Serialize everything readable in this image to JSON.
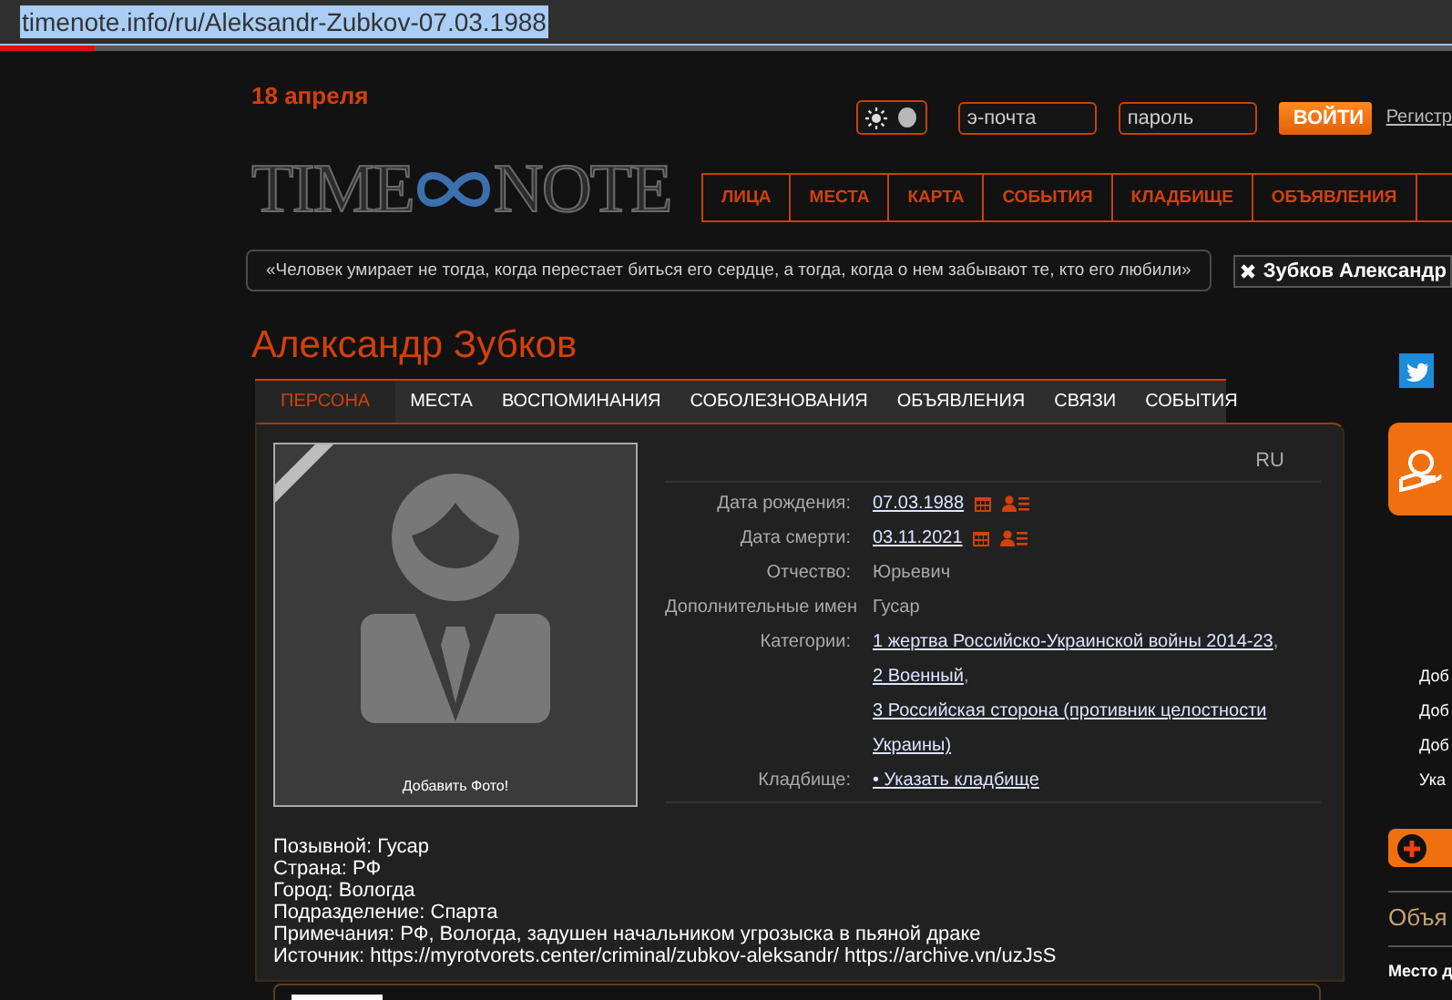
{
  "address_bar": {
    "url": "timenote.info/ru/Aleksandr-Zubkov-07.03.1988",
    "load_progress": {
      "level": 0.065
    }
  },
  "header": {
    "date": "18 апреля",
    "theme_toggle": {
      "on": true
    },
    "email_field": {
      "placeholder": "э-почта"
    },
    "password_field": {
      "placeholder": "пароль"
    },
    "login_button": "ВОЙТИ",
    "register_link": "Регистр"
  },
  "logo": {
    "left": "TIME",
    "right": "NOTE"
  },
  "nav": [
    {
      "label": "ЛИЦА"
    },
    {
      "label": "МЕСТА"
    },
    {
      "label": "КАРТА"
    },
    {
      "label": "СОБЫТИЯ"
    },
    {
      "label": "КЛАДБИЩЕ"
    },
    {
      "label": "ОБЪЯВЛЕНИЯ"
    }
  ],
  "quote": "«Человек умирает не тогда, когда перестает биться его сердце, а тогда, когда о нем забывают те, кто его любили»",
  "search_chip": {
    "label": "Зубков Александр"
  },
  "person": {
    "name": "Александр Зубков"
  },
  "tabs": [
    {
      "label": "ПЕРСОНА",
      "selected": true
    },
    {
      "label": "МЕСТА",
      "selected": false
    },
    {
      "label": "ВОСПОМИНАНИЯ",
      "selected": false
    },
    {
      "label": "СОБОЛЕЗНОВАНИЯ",
      "selected": false
    },
    {
      "label": "ОБЪЯВЛЕНИЯ",
      "selected": false
    },
    {
      "label": "СВЯЗИ",
      "selected": false
    },
    {
      "label": "СОБЫТИЯ",
      "selected": false
    }
  ],
  "profile": {
    "language": "RU",
    "photo_caption": "Добавить Фото!",
    "facts": [
      {
        "kind": "date",
        "label": "Дата рождения:",
        "value": "07.03.1988"
      },
      {
        "kind": "date",
        "label": "Дата смерти:",
        "value": "03.11.2021"
      },
      {
        "kind": "text",
        "label": "Отчество:",
        "value": "Юрьевич"
      },
      {
        "kind": "text",
        "label": "Дополнительные имен",
        "value": "Гусар"
      },
      {
        "kind": "links",
        "label": "Категории:",
        "separator": ", ",
        "links": [
          "1 жертва Российско-Украинской войны 2014-23",
          "2 Военный",
          "3 Российская сторона (противник целостности Украины)"
        ]
      },
      {
        "kind": "links",
        "label": "Кладбище:",
        "links": [
          "• Указать кладбище"
        ]
      }
    ],
    "notes": [
      "Позывной: Гусар",
      "Страна: РФ",
      "Город: Вологда",
      "Подразделение: Спарта",
      "Примечания: РФ, Вологда, задушен начальником угрозыска в пьяной драке",
      "Источник: https://myrotvorets.center/criminal/zubkov-aleksandr/ https://archive.vn/uzJsS"
    ]
  },
  "sidebar": {
    "items": [
      "Доб",
      "Доб",
      "Доб",
      "Ука"
    ],
    "heading": "Объя",
    "place": "Место д"
  }
}
